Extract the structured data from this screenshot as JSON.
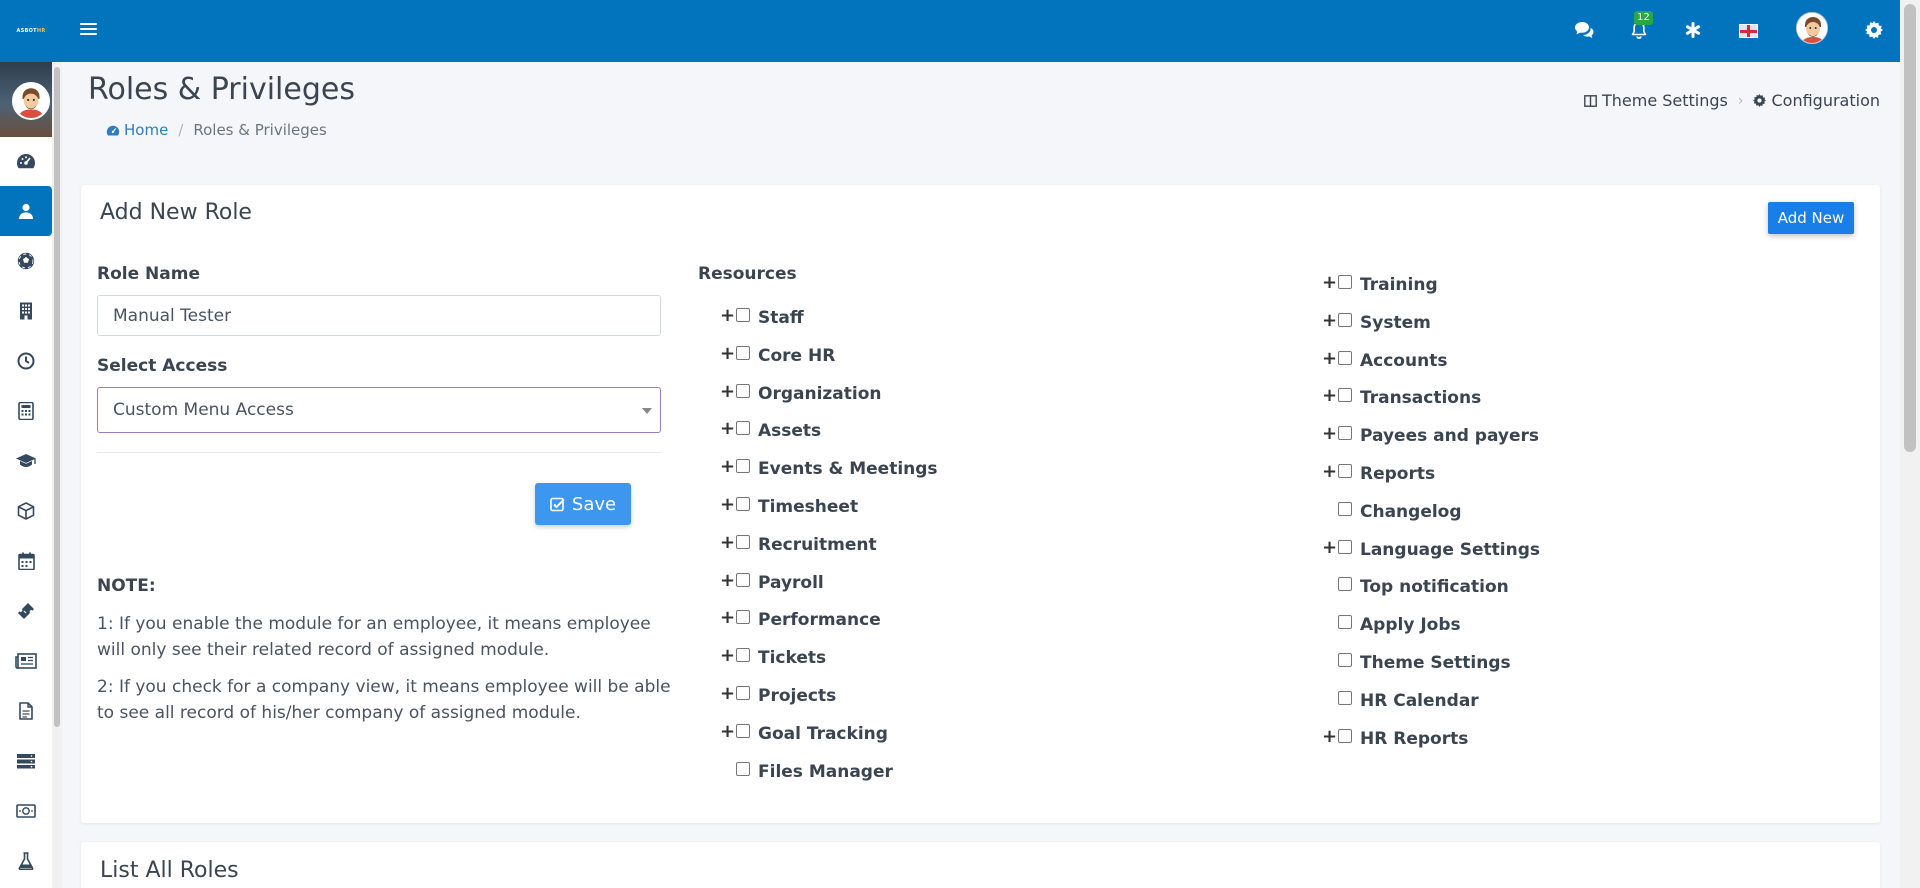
{
  "colors": {
    "primary": "#0274be",
    "button": "#1a7ee8",
    "save": "#3d97f0",
    "badge": "#28a745"
  },
  "header": {
    "logo_text": "ASBOT",
    "logo_suffix": "HR",
    "notification_count": "12",
    "icons": [
      "menu-icon",
      "chat-icon",
      "bell-icon",
      "asterisk-icon",
      "flag-icon",
      "avatar",
      "gear-icon"
    ]
  },
  "sidebar": {
    "items": [
      "dashboard-icon",
      "user-icon",
      "futbol-icon",
      "building-icon",
      "clock-icon",
      "calculator-icon",
      "graduation-cap-icon",
      "cube-icon",
      "calendar-icon",
      "ticket-icon",
      "newspaper-icon",
      "file-icon",
      "server-icon",
      "money-icon",
      "flask-icon"
    ],
    "active_index": 1
  },
  "page": {
    "title": "Roles & Privileges",
    "breadcrumb": {
      "home": "Home",
      "current": "Roles & Privileges"
    },
    "theme_settings": "Theme Settings",
    "configuration": "Configuration"
  },
  "form": {
    "card_title": "Add New Role",
    "add_new": "Add New",
    "role_name_label": "Role Name",
    "role_name_value": "Manual Tester",
    "select_access_label": "Select Access",
    "select_access_value": "Custom Menu Access",
    "save": "Save",
    "note_title": "NOTE:",
    "note_1": "1: If you enable the module for an employee, it means employee will only see their related record of assigned module.",
    "note_2": "2: If you check for a company view, it means employee will be able to see all record of his/her company of assigned module."
  },
  "resources": {
    "label": "Resources",
    "col1": [
      {
        "name": "Staff",
        "expandable": true
      },
      {
        "name": "Core HR",
        "expandable": true
      },
      {
        "name": "Organization",
        "expandable": true
      },
      {
        "name": "Assets",
        "expandable": true
      },
      {
        "name": "Events & Meetings",
        "expandable": true
      },
      {
        "name": "Timesheet",
        "expandable": true
      },
      {
        "name": "Recruitment",
        "expandable": true
      },
      {
        "name": "Payroll",
        "expandable": true
      },
      {
        "name": "Performance",
        "expandable": true
      },
      {
        "name": "Tickets",
        "expandable": true
      },
      {
        "name": "Projects",
        "expandable": true
      },
      {
        "name": "Goal Tracking",
        "expandable": true
      },
      {
        "name": "Files Manager",
        "expandable": false
      }
    ],
    "col2": [
      {
        "name": "Training",
        "expandable": true
      },
      {
        "name": "System",
        "expandable": true
      },
      {
        "name": "Accounts",
        "expandable": true
      },
      {
        "name": "Transactions",
        "expandable": true
      },
      {
        "name": "Payees and payers",
        "expandable": true
      },
      {
        "name": "Reports",
        "expandable": true
      },
      {
        "name": "Changelog",
        "expandable": false
      },
      {
        "name": "Language Settings",
        "expandable": true
      },
      {
        "name": "Top notification",
        "expandable": false
      },
      {
        "name": "Apply Jobs",
        "expandable": false
      },
      {
        "name": "Theme Settings",
        "expandable": false
      },
      {
        "name": "HR Calendar",
        "expandable": false
      },
      {
        "name": "HR Reports",
        "expandable": true
      }
    ]
  },
  "list": {
    "title": "List All Roles"
  }
}
